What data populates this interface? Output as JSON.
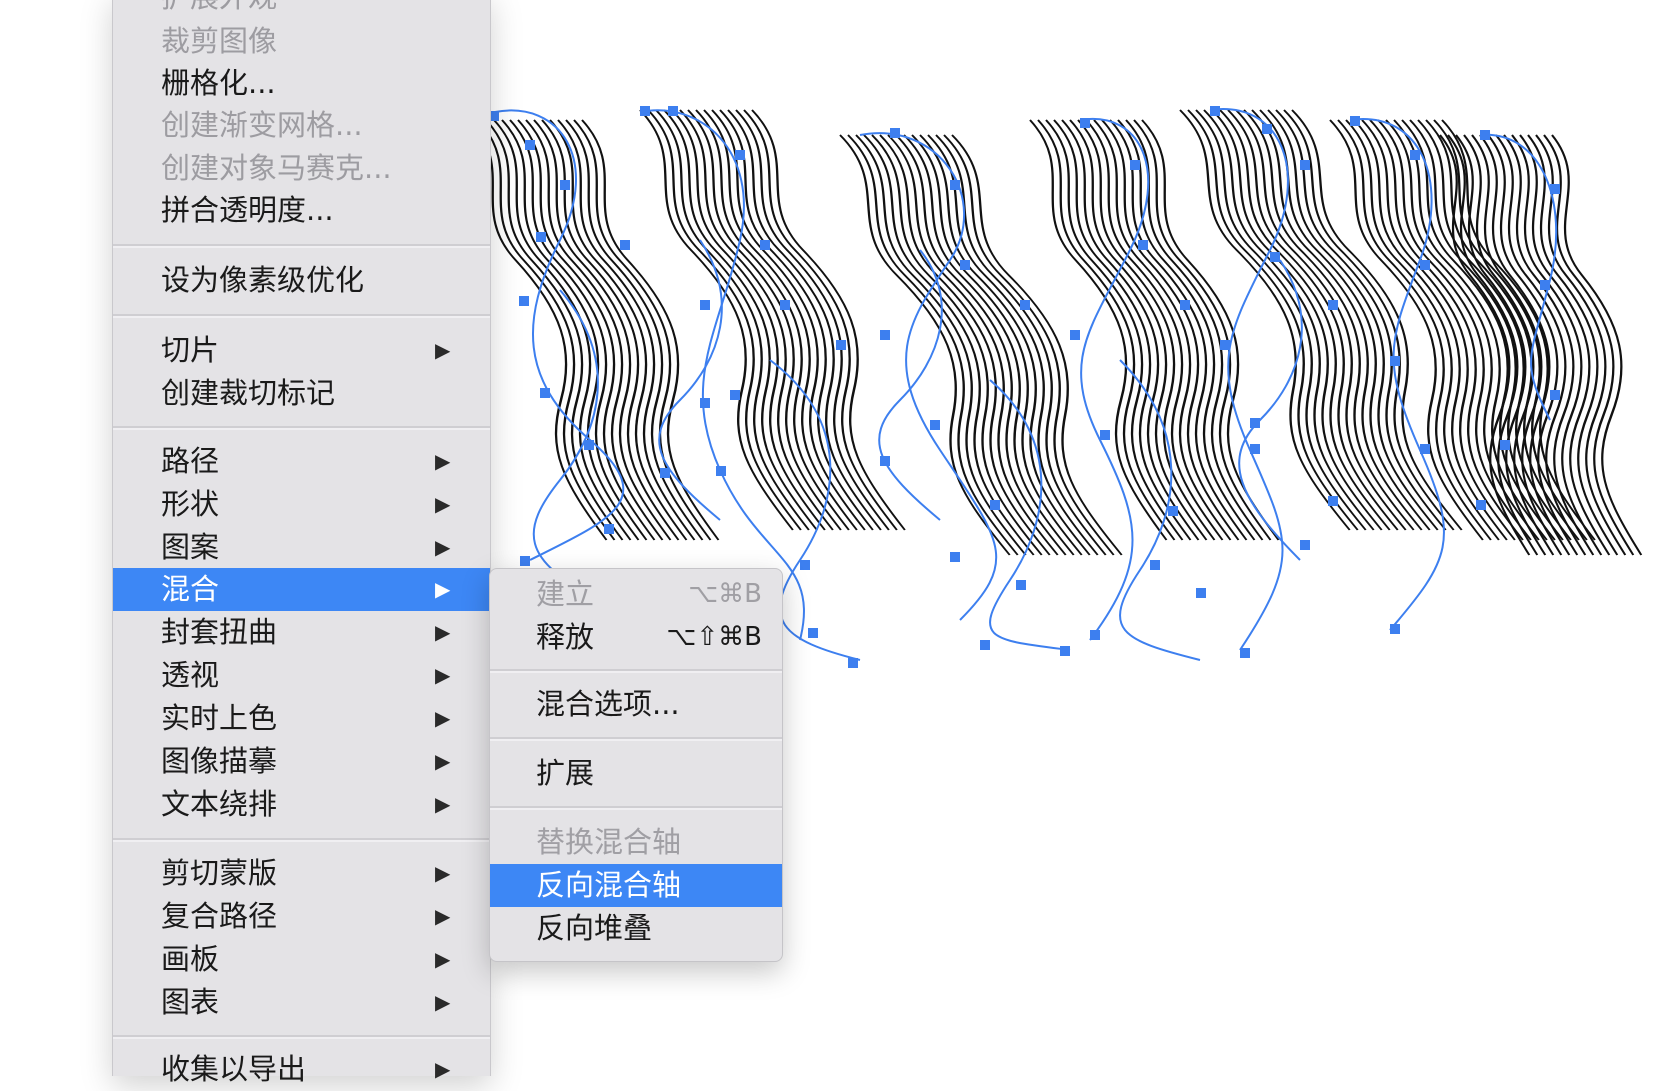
{
  "menu": {
    "items": [
      {
        "label": "扩展外观",
        "enabled": false,
        "submenu": false
      },
      {
        "label": "裁剪图像",
        "enabled": false,
        "submenu": false
      },
      {
        "label": "栅格化...",
        "enabled": true,
        "submenu": false
      },
      {
        "label": "创建渐变网格...",
        "enabled": false,
        "submenu": false
      },
      {
        "label": "创建对象马赛克...",
        "enabled": false,
        "submenu": false
      },
      {
        "label": "拼合透明度...",
        "enabled": true,
        "submenu": false
      },
      {
        "label": "设为像素级优化",
        "enabled": true,
        "submenu": false
      },
      {
        "label": "切片",
        "enabled": true,
        "submenu": true
      },
      {
        "label": "创建裁切标记",
        "enabled": true,
        "submenu": false
      },
      {
        "label": "路径",
        "enabled": true,
        "submenu": true
      },
      {
        "label": "形状",
        "enabled": true,
        "submenu": true
      },
      {
        "label": "图案",
        "enabled": true,
        "submenu": true
      },
      {
        "label": "混合",
        "enabled": true,
        "submenu": true,
        "highlighted": true
      },
      {
        "label": "封套扭曲",
        "enabled": true,
        "submenu": true
      },
      {
        "label": "透视",
        "enabled": true,
        "submenu": true
      },
      {
        "label": "实时上色",
        "enabled": true,
        "submenu": true
      },
      {
        "label": "图像描摹",
        "enabled": true,
        "submenu": true
      },
      {
        "label": "文本绕排",
        "enabled": true,
        "submenu": true
      },
      {
        "label": "剪切蒙版",
        "enabled": true,
        "submenu": true
      },
      {
        "label": "复合路径",
        "enabled": true,
        "submenu": true
      },
      {
        "label": "画板",
        "enabled": true,
        "submenu": true
      },
      {
        "label": "图表",
        "enabled": true,
        "submenu": true
      },
      {
        "label": "收集以导出",
        "enabled": true,
        "submenu": true
      }
    ],
    "submenu_arrow": "▶"
  },
  "submenu": {
    "items": [
      {
        "label": "建立",
        "shortcut": "⌥⌘B",
        "enabled": false
      },
      {
        "label": "释放",
        "shortcut": "⌥⇧⌘B",
        "enabled": true
      },
      {
        "label": "混合选项...",
        "shortcut": "",
        "enabled": true
      },
      {
        "label": "扩展",
        "shortcut": "",
        "enabled": true
      },
      {
        "label": "替换混合轴",
        "shortcut": "",
        "enabled": false
      },
      {
        "label": "反向混合轴",
        "shortcut": "",
        "enabled": true,
        "highlighted": true
      },
      {
        "label": "反向堆叠",
        "shortcut": "",
        "enabled": true
      }
    ]
  },
  "colors": {
    "menu_background": "#e4e3e6",
    "highlight": "#3d87f5",
    "anchor_points": "#3d7fef",
    "blend_strokes": "#111111",
    "disabled_text": "#9d9ca1"
  },
  "icons": {
    "submenu_indicator": "triangle-right-icon",
    "anchor_point": "square-anchor-icon"
  }
}
